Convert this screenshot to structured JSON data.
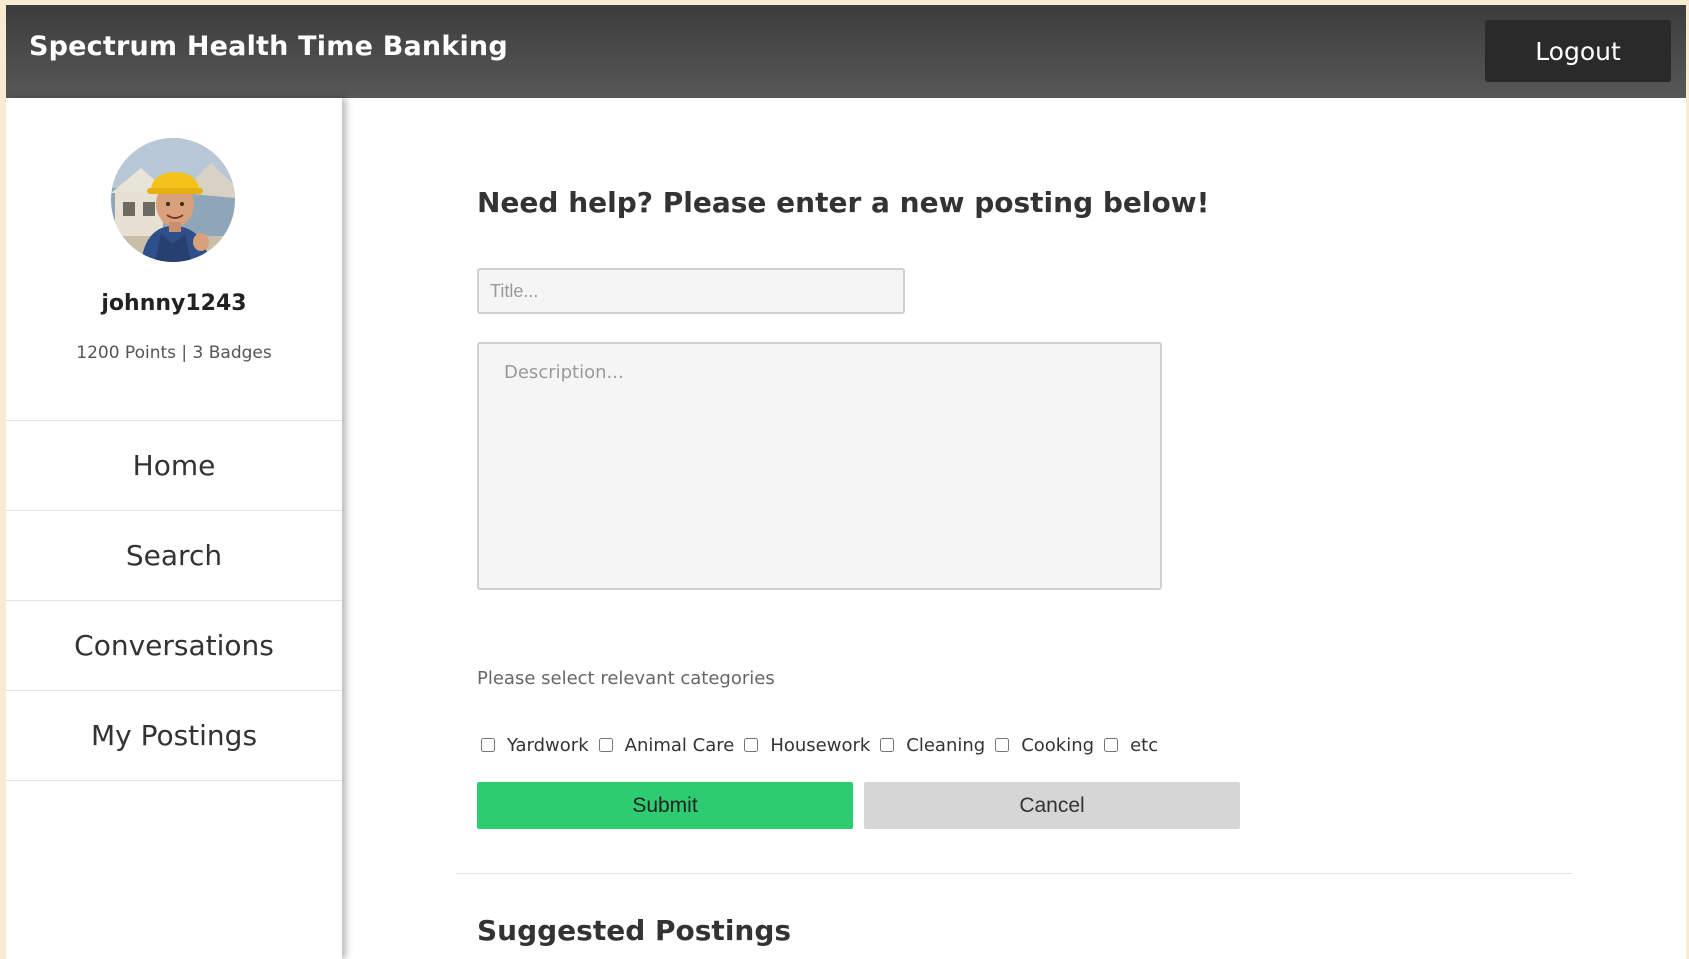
{
  "header": {
    "title": "Spectrum Health Time Banking",
    "logout_label": "Logout"
  },
  "profile": {
    "username": "johnny1243",
    "stats": "1200 Points | 3 Badges",
    "avatar_icon": "profile-photo-construction-worker"
  },
  "sidebar": {
    "items": [
      {
        "label": "Home"
      },
      {
        "label": "Search"
      },
      {
        "label": "Conversations"
      },
      {
        "label": "My Postings"
      }
    ]
  },
  "form": {
    "heading": "Need help? Please enter a new posting below!",
    "title_placeholder": "Title...",
    "title_value": "",
    "description_placeholder": "Description...",
    "description_value": "",
    "categories_label": "Please select relevant categories",
    "categories": [
      {
        "label": "Yardwork",
        "checked": false
      },
      {
        "label": "Animal Care",
        "checked": false
      },
      {
        "label": "Housework",
        "checked": false
      },
      {
        "label": "Cleaning",
        "checked": false
      },
      {
        "label": "Cooking",
        "checked": false
      },
      {
        "label": "etc",
        "checked": false
      }
    ],
    "submit_label": "Submit",
    "cancel_label": "Cancel"
  },
  "suggested": {
    "heading": "Suggested Postings"
  },
  "colors": {
    "header_bg": "#4a4a4a",
    "submit_green": "#2ecc71",
    "cancel_gray": "#d6d6d6",
    "page_border": "#f7ecd2"
  }
}
